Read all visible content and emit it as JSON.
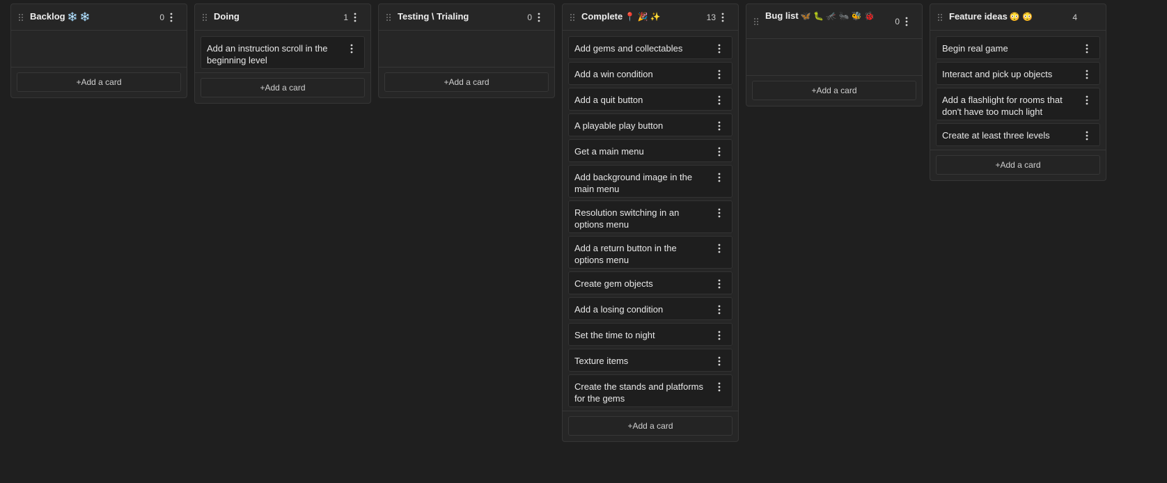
{
  "board": {
    "add_card_label": "+Add a card",
    "columns": [
      {
        "title": "Backlog",
        "emoji": "❄️ ❄️",
        "count": "0",
        "cards": []
      },
      {
        "title": "Doing",
        "emoji": "",
        "count": "1",
        "cards": [
          "Add an instruction scroll in the beginning level"
        ]
      },
      {
        "title": "Testing \\ Trialing",
        "emoji": "",
        "count": "0",
        "cards": []
      },
      {
        "title": "Complete",
        "emoji": "📍 🎉 ✨",
        "count": "13",
        "cards": [
          "Add gems and collectables",
          "Add a win condition",
          "Add a quit button",
          "A playable play button",
          "Get a main menu",
          "Add background image in the main menu",
          "Resolution switching in an options menu",
          "Add a return button in the options menu",
          "Create gem objects",
          "Add a losing condition",
          "Set the time to night",
          "Texture items",
          "Create the stands and platforms for the gems"
        ]
      },
      {
        "title": "Bug list",
        "emoji": "🦋 🐛 🦟 🐜 🐝 🐞",
        "count": "0",
        "cards": []
      },
      {
        "title": "Feature ideas",
        "emoji": "😳 😳",
        "count": "4",
        "cards": [
          "Begin real game",
          "Interact and pick up objects",
          "Add a flashlight for rooms that don't have too much light",
          "Create at least three levels"
        ]
      }
    ]
  },
  "icons": {
    "drag": "drag-handle-icon",
    "menu": "more-vertical-icon"
  }
}
